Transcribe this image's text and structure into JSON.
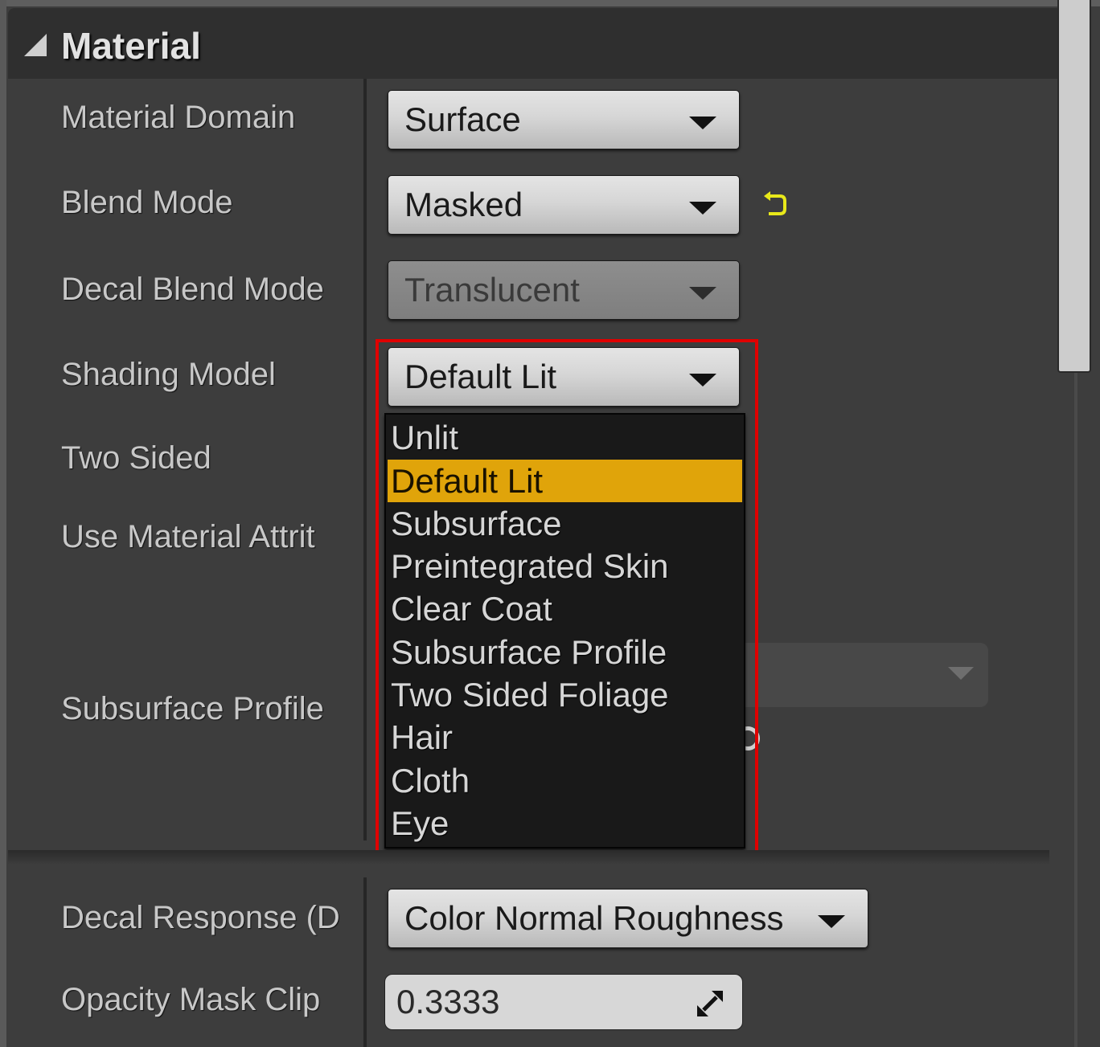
{
  "section": {
    "title": "Material"
  },
  "properties": [
    {
      "label": "Material Domain",
      "value": "Surface"
    },
    {
      "label": "Blend Mode",
      "value": "Masked",
      "reset_icon": "reset-to-default-arrow-icon"
    },
    {
      "label": "Decal Blend Mode",
      "value": "Translucent",
      "disabled": true
    },
    {
      "label": "Shading Model",
      "value": "Default Lit"
    },
    {
      "label": "Two Sided"
    },
    {
      "label": "Use Material Attrit"
    },
    {
      "label": "Subsurface Profile"
    },
    {
      "label": "Decal Response (D",
      "value": "Color Normal Roughness"
    },
    {
      "label": "Opacity Mask Clip",
      "value": "0.3333"
    }
  ],
  "shading_dropdown": {
    "selected": "Default Lit",
    "options": [
      "Unlit",
      "Default Lit",
      "Subsurface",
      "Preintegrated Skin",
      "Clear Coat",
      "Subsurface Profile",
      "Two Sided Foliage",
      "Hair",
      "Cloth",
      "Eye"
    ]
  },
  "colors": {
    "highlight_border": "#e00000",
    "selected_option": "#e0a40a",
    "reset_icon": "#e8e81a"
  }
}
